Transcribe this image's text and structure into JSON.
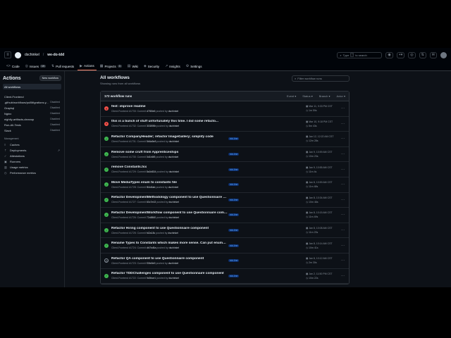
{
  "repo": {
    "owner": "dschinkel",
    "name": "we-do-tdd"
  },
  "topbar": {
    "search_label": "Type",
    "search_kbd": "/",
    "search_suffix": "to search",
    "plus": "+",
    "caret": "▾"
  },
  "tabs": [
    {
      "label": "Code",
      "icon": "<>"
    },
    {
      "label": "Issues",
      "icon": "◎",
      "count": "19"
    },
    {
      "label": "Pull requests",
      "icon": "⇅"
    },
    {
      "label": "Actions",
      "icon": "▶"
    },
    {
      "label": "Projects",
      "icon": "▦",
      "count": "3"
    },
    {
      "label": "Wiki",
      "icon": "▤"
    },
    {
      "label": "Security",
      "icon": "◈"
    },
    {
      "label": "Insights",
      "icon": "↗"
    },
    {
      "label": "Settings",
      "icon": "⚙"
    }
  ],
  "sidebar": {
    "title": "Actions",
    "new_workflow": "New workflow",
    "all_workflows": "All workflows",
    "workflows": [
      {
        "label": "Client-Frontend",
        "status": ""
      },
      {
        "label": ".github/workflows/pullMigrations.y...",
        "status": "Disabled"
      },
      {
        "label": "Graphql",
        "status": "Disabled"
      },
      {
        "label": "Nginx",
        "status": "Disabled"
      },
      {
        "label": "nightly-artifacts-cleanup",
        "status": "Disabled"
      },
      {
        "label": "Run-All-Tests",
        "status": "Disabled"
      },
      {
        "label": "Slack",
        "status": "Disabled"
      }
    ],
    "management_label": "Management",
    "management": [
      {
        "label": "Caches",
        "icon": "≡",
        "ext": ""
      },
      {
        "label": "Deployments",
        "icon": "⇡",
        "ext": "↗"
      },
      {
        "label": "Attestations",
        "icon": "✓",
        "ext": ""
      },
      {
        "label": "Runners",
        "icon": "▣",
        "ext": ""
      },
      {
        "label": "Usage metrics",
        "icon": "▥",
        "ext": ""
      },
      {
        "label": "Performance metrics",
        "icon": "◷",
        "ext": ""
      }
    ]
  },
  "main": {
    "title": "All workflows",
    "subtitle": "Showing runs from all workflows",
    "filter_placeholder": "Filter workflow runs",
    "run_count": "172 workflow runs",
    "filters": [
      "Event ▾",
      "Status ▾",
      "Branch ▾",
      "Actor ▾"
    ]
  },
  "runs": [
    {
      "status": "fail",
      "title": "fest: improve readme",
      "meta_prefix": "Client-Frontend #1733: Commit",
      "sha": "d7f65e6",
      "actor": "dschinkel",
      "branch": "",
      "date": "Mar 11, 9:33 PM CST",
      "duration": "1m 59s"
    },
    {
      "status": "fail",
      "title": "this is a bunch of stuff unfortunately this time. I did some refacto...",
      "meta_prefix": "Client-Frontend #1732: Commit",
      "sha": "303895b",
      "actor": "dschinkel",
      "branch": "",
      "date": "Mar 10, 9:18 PM CST",
      "duration": "5m 43s"
    },
    {
      "status": "success",
      "title": "Refactor CompanyHeader; refactor ImageGallery; simplify code",
      "meta_prefix": "Client-Frontend #1731: Commit",
      "sha": "5b6a5e8",
      "actor": "dschinkel",
      "branch": "tdd-line",
      "date": "Jan 12, 12:22 AM CST",
      "duration": "12m 28s"
    },
    {
      "status": "success",
      "title": "Remove some cruft from Apprenticeships",
      "meta_prefix": "Client-Frontend #1730: Commit",
      "sha": "0d1b6f5",
      "actor": "dschinkel",
      "branch": "tdd-line",
      "date": "Jan 9, 10:59 AM CST",
      "duration": "10m 23s"
    },
    {
      "status": "success",
      "title": "remove Constants.tsx",
      "meta_prefix": "Client-Frontend #1729: Commit",
      "sha": "8a0d634",
      "actor": "dschinkel",
      "branch": "tdd-line",
      "date": "Jan 9, 10:55 AM CST",
      "duration": "11m 4s"
    },
    {
      "status": "success",
      "title": "Move MediaTypes enum to constants file",
      "meta_prefix": "Client-Frontend #1728: Commit",
      "sha": "f84d6ab",
      "actor": "dschinkel",
      "branch": "tdd-line",
      "date": "Jan 8, 10:59 AM CST",
      "duration": "11m 48s"
    },
    {
      "status": "success",
      "title": "Refactor DevelopmentMethodology component to use Questionnaire comp...",
      "meta_prefix": "Client-Frontend #1727: Commit",
      "sha": "60c7e43",
      "actor": "dschinkel",
      "branch": "tdd-line",
      "date": "Jan 8, 10:34 AM CST",
      "duration": "10m 46s"
    },
    {
      "status": "success",
      "title": "Refactor DevelopmentWorkflow component to use Questionnaire component",
      "meta_prefix": "Client-Frontend #1726: Commit",
      "sha": "72c8860",
      "actor": "dschinkel",
      "branch": "tdd-line",
      "date": "Jan 8, 10:15 AM CST",
      "duration": "11m 49s"
    },
    {
      "status": "success",
      "title": "Refactor Hiring component to use Questionnaire component",
      "meta_prefix": "Client-Frontend #1725: Commit",
      "sha": "fd2a18c",
      "actor": "dschinkel",
      "branch": "tdd-line",
      "date": "Jan 8, 10:08 AM CST",
      "duration": "11m 23s"
    },
    {
      "status": "success",
      "title": "Rename Types to Constants which makes more sense. Can put enums and ...",
      "meta_prefix": "Client-Frontend #1724: Commit",
      "sha": "db7bd5a",
      "actor": "dschinkel",
      "branch": "tdd-line",
      "date": "Jan 8, 10:14 AM CST",
      "duration": "10m 41s"
    },
    {
      "status": "cancel",
      "title": "Refactor QA component to use Questionnaire component",
      "meta_prefix": "Client-Frontend #1723: Commit",
      "sha": "f39e8e9",
      "actor": "dschinkel",
      "branch": "tdd-line",
      "date": "Jan 8, 10:12 AM CST",
      "duration": "2m 30s"
    },
    {
      "status": "success",
      "title": "Refactor TDDChallenges component to use Questionnaire component",
      "meta_prefix": "Client-Frontend #1722: Commit",
      "sha": "9d0bce1",
      "actor": "dschinkel",
      "branch": "tdd-line",
      "date": "Jan 2, 11:50 PM CST",
      "duration": "10m 22s"
    }
  ]
}
